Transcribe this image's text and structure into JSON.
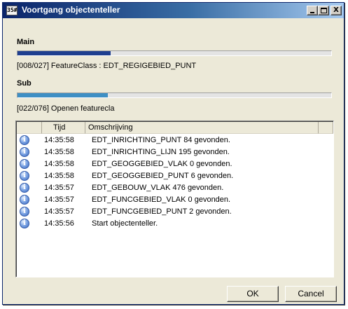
{
  "window": {
    "title": "Voortgang objectenteller",
    "app_icon_text": "35#",
    "controls": {
      "close_glyph": "X"
    }
  },
  "main": {
    "label": "Main",
    "progress_fraction": 0.296,
    "progress_color": "#1f3f8f",
    "status": "[008/027] FeatureClass : EDT_REGIGEBIED_PUNT"
  },
  "sub": {
    "label": "Sub",
    "progress_fraction": 0.289,
    "progress_color": "#3e8fc4",
    "status": "[022/076] Openen featurecla"
  },
  "log": {
    "columns": [
      "",
      "Tijd",
      "Omschrijving",
      ""
    ],
    "icon": "info-icon",
    "icon_glyph": "i",
    "rows": [
      {
        "time": "14:35:58",
        "description": "EDT_INRICHTING_PUNT 84 gevonden."
      },
      {
        "time": "14:35:58",
        "description": "EDT_INRICHTING_LIJN 195 gevonden."
      },
      {
        "time": "14:35:58",
        "description": "EDT_GEOGGEBIED_VLAK 0 gevonden."
      },
      {
        "time": "14:35:58",
        "description": "EDT_GEOGGEBIED_PUNT 6 gevonden."
      },
      {
        "time": "14:35:57",
        "description": "EDT_GEBOUW_VLAK 476 gevonden."
      },
      {
        "time": "14:35:57",
        "description": "EDT_FUNCGEBIED_VLAK 0 gevonden."
      },
      {
        "time": "14:35:57",
        "description": "EDT_FUNCGEBIED_PUNT 2 gevonden."
      },
      {
        "time": "14:35:56",
        "description": "Start objectenteller."
      }
    ]
  },
  "buttons": {
    "ok": "OK",
    "cancel": "Cancel"
  }
}
